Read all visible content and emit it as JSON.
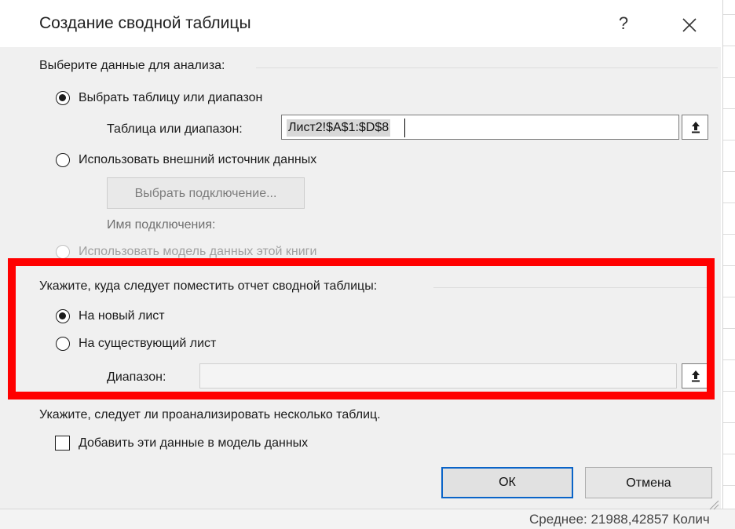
{
  "dialog": {
    "title": "Создание сводной таблицы",
    "help_label": "?",
    "close_icon": "close-icon"
  },
  "source": {
    "heading": "Выберите данные для анализа:",
    "option_table": "Выбрать таблицу или диапазон",
    "range_label": "Таблица или диапазон:",
    "range_value": "Лист2!$A$1:$D$8",
    "option_external": "Использовать внешний источник данных",
    "choose_connection_label": "Выбрать подключение...",
    "connection_name_label": "Имя подключения:",
    "option_model": "Использовать модель данных этой книги",
    "selected": "table"
  },
  "destination": {
    "heading": "Укажите, куда следует поместить отчет сводной таблицы:",
    "option_new_sheet": "На новый лист",
    "option_existing_sheet": "На существующий лист",
    "range_label": "Диапазон:",
    "range_value": "",
    "selected": "new_sheet"
  },
  "analysis": {
    "heading": "Укажите, следует ли проанализировать несколько таблиц.",
    "add_to_model_label": "Добавить эти данные в модель данных",
    "add_to_model_checked": false
  },
  "buttons": {
    "ok": "ОК",
    "cancel": "Отмена"
  },
  "statusbar": {
    "text": "Среднее: 21988,42857    Колич"
  },
  "colors": {
    "highlight": "#ff0000",
    "primary_border": "#0a64c8",
    "dialog_bg": "#f0f0f0"
  },
  "icons": {
    "collapse": "collapse-dialog-icon",
    "grip": "resize-grip-icon"
  }
}
